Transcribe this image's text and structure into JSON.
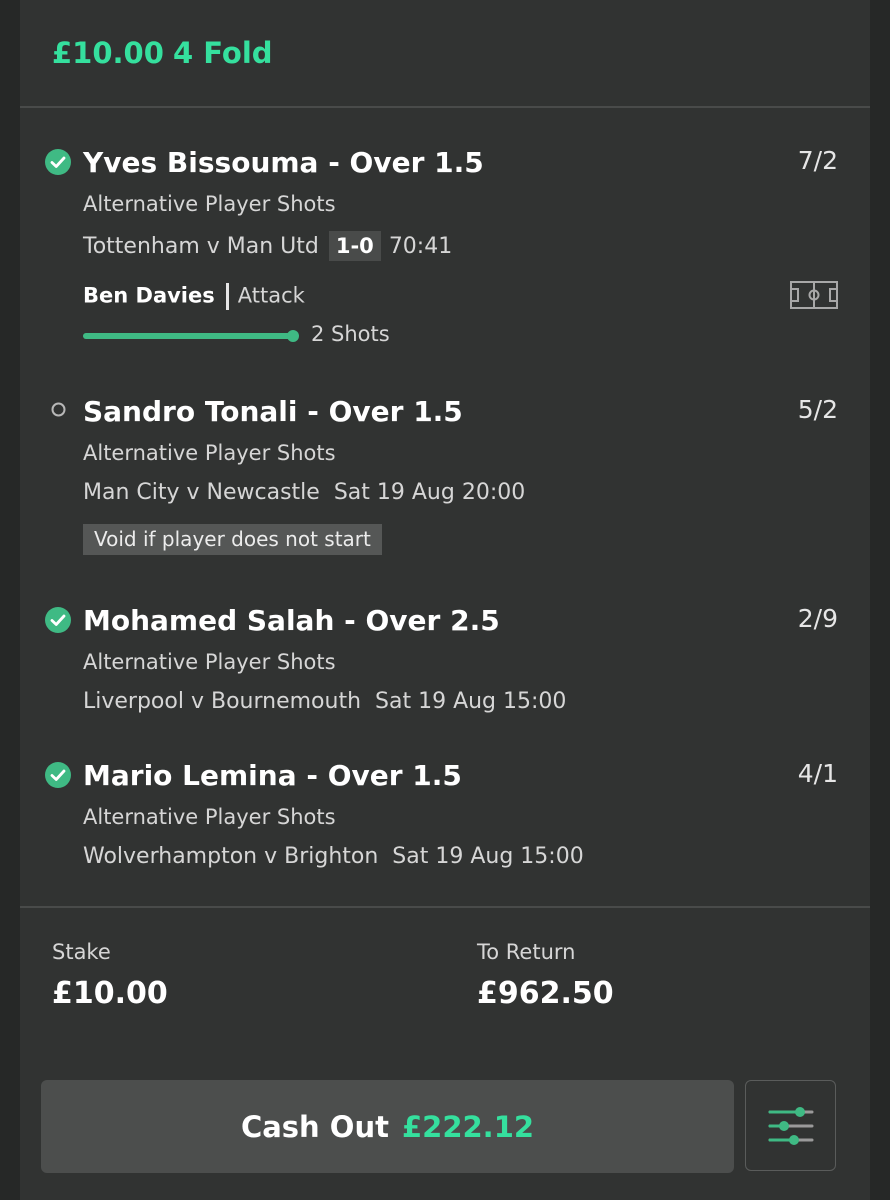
{
  "header": {
    "stake": "£10.00",
    "bet_type": "4 Fold"
  },
  "legs": [
    {
      "status": "won",
      "title": "Yves Bissouma - Over 1.5",
      "odds": "7/2",
      "market": "Alternative Player Shots",
      "event": "Tottenham v Man Utd",
      "score": "1-0",
      "time": "70:41",
      "tracker": {
        "player": "Ben Davies",
        "position": "Attack",
        "progress_fraction": 1.0,
        "progress_label": "2 Shots"
      }
    },
    {
      "status": "open",
      "title": "Sandro Tonali - Over 1.5",
      "odds": "5/2",
      "market": "Alternative Player Shots",
      "event": "Man City v Newcastle",
      "time": "Sat 19 Aug 20:00",
      "note": "Void if player does not start"
    },
    {
      "status": "won",
      "title": "Mohamed Salah - Over 2.5",
      "odds": "2/9",
      "market": "Alternative Player Shots",
      "event": "Liverpool v Bournemouth",
      "time": "Sat 19 Aug 15:00"
    },
    {
      "status": "won",
      "title": "Mario Lemina - Over 1.5",
      "odds": "4/1",
      "market": "Alternative Player Shots",
      "event": "Wolverhampton v Brighton",
      "time": "Sat 19 Aug 15:00"
    }
  ],
  "summary": {
    "stake_label": "Stake",
    "stake_value": "£10.00",
    "return_label": "To Return",
    "return_value": "£962.50"
  },
  "cashout": {
    "label": "Cash Out",
    "amount": "£222.12"
  },
  "icons": {
    "won": "check-circle-icon",
    "open": "open-circle-icon",
    "pitch": "pitch-icon",
    "settings": "sliders-icon"
  },
  "colors": {
    "accent": "#35e09e",
    "won": "#3fba84",
    "background": "#313332"
  }
}
